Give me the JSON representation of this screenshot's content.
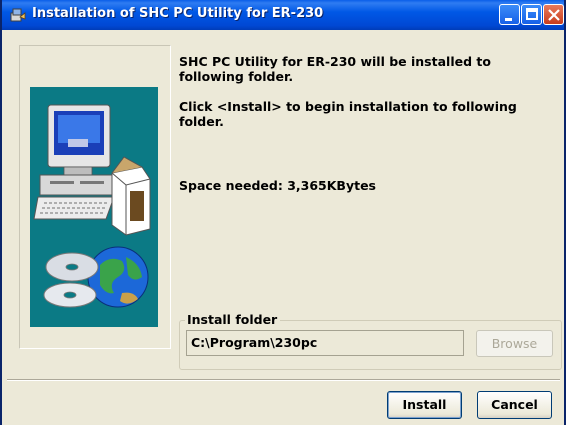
{
  "window": {
    "title": "Installation of SHC PC Utility for ER-230",
    "app_icon": "setup-icon",
    "controls": [
      "minimize-icon",
      "maximize-icon",
      "close-icon"
    ]
  },
  "art": {
    "description_icon": "computer-globe-cd-icon",
    "background_color": "#0b7a85"
  },
  "messages": {
    "line1": "SHC PC Utility for ER-230 will be installed to following folder.",
    "line2": "Click <Install> to begin installation to following folder.",
    "space": "Space needed: 3,365KBytes"
  },
  "install_folder": {
    "legend": "Install folder",
    "path": "C:\\Program\\230pc",
    "browse_label": "Browse"
  },
  "buttons": {
    "install": "Install",
    "cancel": "Cancel"
  },
  "colors": {
    "titlebar": "#0058e6",
    "dialog_bg": "#ece9d8",
    "close_button": "#c83c1c"
  }
}
